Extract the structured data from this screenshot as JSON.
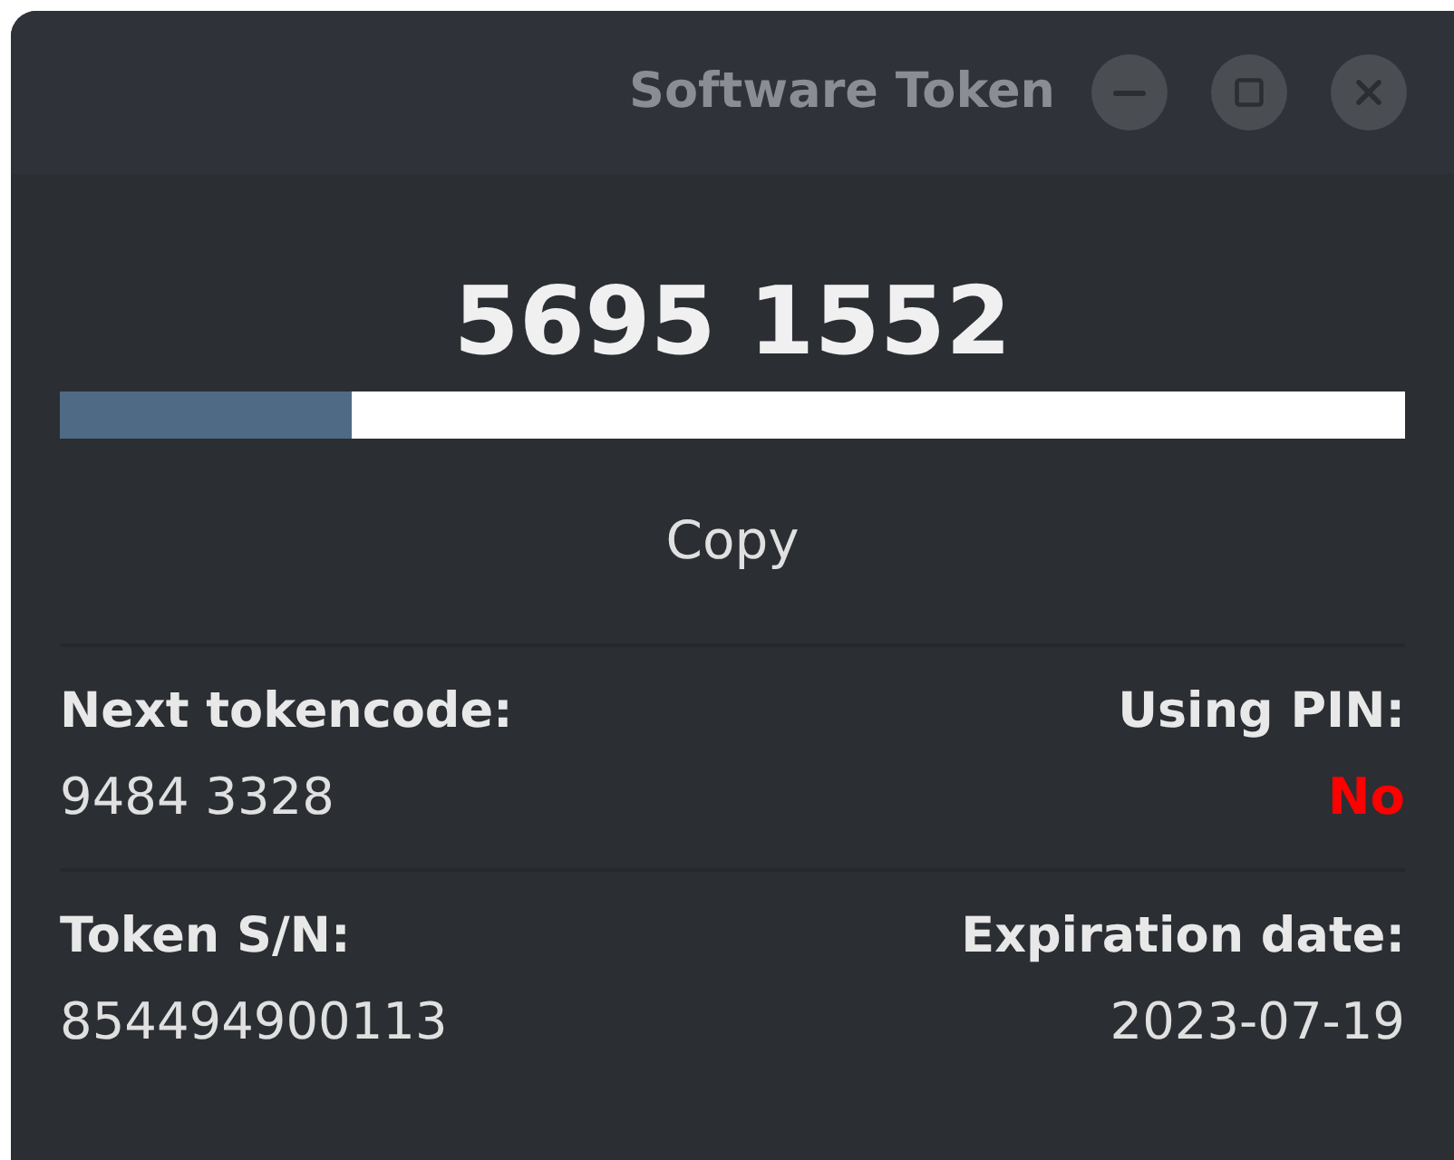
{
  "window": {
    "title": "Software Token"
  },
  "tokencode": "5695 1552",
  "progress": {
    "level": 0.217
  },
  "copy_button": {
    "label": "Copy"
  },
  "next_tokencode": {
    "label": "Next tokencode:",
    "value": "9484 3328"
  },
  "using_pin": {
    "label": "Using PIN:",
    "value": "No",
    "on": false
  },
  "token_sn": {
    "label": "Token S/N:",
    "value": "854494900113"
  },
  "expiration_date": {
    "label": "Expiration date:",
    "value": "2023-07-19"
  }
}
